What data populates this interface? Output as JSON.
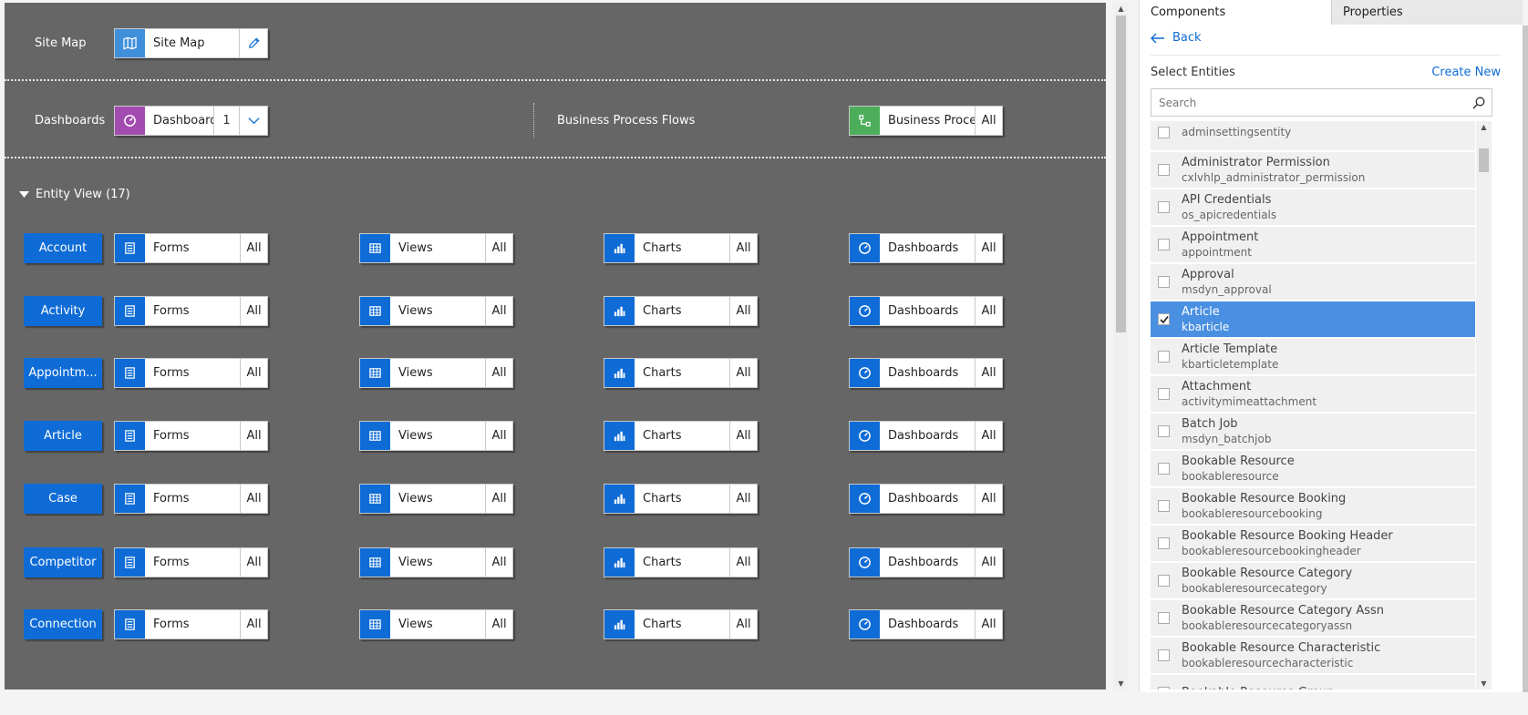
{
  "canvas": {
    "site_map": {
      "row_label": "Site Map",
      "tile_label": "Site Map"
    },
    "dashboards": {
      "row_label": "Dashboards",
      "tile_label": "Dashboards",
      "count": "1"
    },
    "bpf": {
      "row_label": "Business Process Flows",
      "tile_label": "Business Proces...",
      "all": "All"
    },
    "entity_view_label": "Entity View (17)",
    "column_labels": {
      "forms": "Forms",
      "views": "Views",
      "charts": "Charts",
      "dashboards": "Dashboards",
      "all": "All"
    },
    "entities": [
      "Account",
      "Activity",
      "Appointm...",
      "Article",
      "Case",
      "Competitor",
      "Connection"
    ]
  },
  "panel": {
    "tabs": [
      {
        "label": "Components",
        "active": true
      },
      {
        "label": "Properties",
        "active": false
      }
    ],
    "back_label": "Back",
    "select_entities_label": "Select Entities",
    "create_new_label": "Create New",
    "search_placeholder": "Search",
    "entities": [
      {
        "display": "",
        "logical": "adminsettingsentity",
        "checked": false
      },
      {
        "display": "Administrator Permission",
        "logical": "cxlvhlp_administrator_permission",
        "checked": false
      },
      {
        "display": "API Credentials",
        "logical": "os_apicredentials",
        "checked": false
      },
      {
        "display": "Appointment",
        "logical": "appointment",
        "checked": false
      },
      {
        "display": "Approval",
        "logical": "msdyn_approval",
        "checked": false
      },
      {
        "display": "Article",
        "logical": "kbarticle",
        "checked": true
      },
      {
        "display": "Article Template",
        "logical": "kbarticletemplate",
        "checked": false
      },
      {
        "display": "Attachment",
        "logical": "activitymimeattachment",
        "checked": false
      },
      {
        "display": "Batch Job",
        "logical": "msdyn_batchjob",
        "checked": false
      },
      {
        "display": "Bookable Resource",
        "logical": "bookableresource",
        "checked": false
      },
      {
        "display": "Bookable Resource Booking",
        "logical": "bookableresourcebooking",
        "checked": false
      },
      {
        "display": "Bookable Resource Booking Header",
        "logical": "bookableresourcebookingheader",
        "checked": false
      },
      {
        "display": "Bookable Resource Category",
        "logical": "bookableresourcecategory",
        "checked": false
      },
      {
        "display": "Bookable Resource Category Assn",
        "logical": "bookableresourcecategoryassn",
        "checked": false
      },
      {
        "display": "Bookable Resource Characteristic",
        "logical": "bookableresourcecharacteristic",
        "checked": false
      },
      {
        "display": "Bookable Resource Group",
        "logical": "",
        "checked": false
      }
    ]
  },
  "colors": {
    "accent": "#0f6cd6",
    "canvas_bg": "#666666",
    "selected_row": "#4a90e2",
    "dashboard_icon": "#a24caf",
    "bpf_icon": "#4cae5b"
  }
}
